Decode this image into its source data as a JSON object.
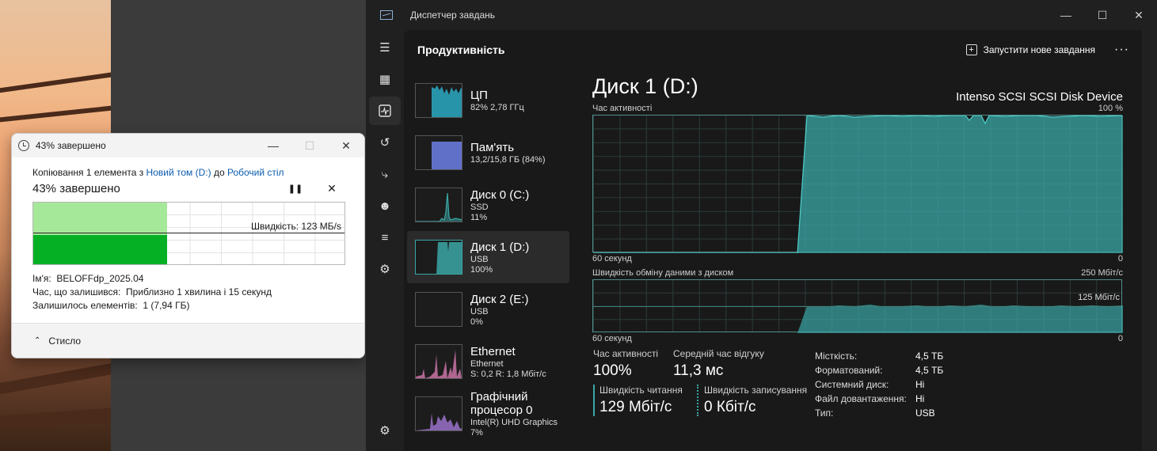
{
  "copy_dialog": {
    "title": "43% завершено",
    "line_prefix": "Копіювання 1 елемента з ",
    "source": "Новий том (D:)",
    "line_mid": " до ",
    "destination": "Робочий стіл",
    "progress_text": "43% завершено",
    "progress_value": 0.43,
    "speed_label": "Швидкість: 123 МБ/s",
    "name_label": "Ім'я:",
    "name_value": "BELOFFdp_2025.04",
    "time_label": "Час, що залишився:",
    "time_value": "Приблизно 1 хвилина і 15 секунд",
    "items_label": "Залишилось елементів:",
    "items_value": "1 (7,94 ГБ)",
    "footer_label": "Стисло"
  },
  "taskmgr": {
    "window_title": "Диспетчер завдань",
    "page_title": "Продуктивність",
    "run_task_label": "Запустити нове завдання",
    "nav_icons": [
      "menu-icon",
      "processes-icon",
      "performance-icon",
      "history-icon",
      "startup-icon",
      "users-icon",
      "details-icon",
      "services-icon"
    ],
    "resources": [
      {
        "name": "ЦП",
        "sub1": "82% 2,78 ГГц",
        "sub2": "",
        "color": "#2aa9c3"
      },
      {
        "name": "Пам'ять",
        "sub1": "13,2/15,8 ГБ (84%)",
        "sub2": "",
        "color": "#6c7fe8"
      },
      {
        "name": "Диск 0 (C:)",
        "sub1": "SSD",
        "sub2": "11%",
        "color": "#3aa7a6"
      },
      {
        "name": "Диск 1 (D:)",
        "sub1": "USB",
        "sub2": "100%",
        "color": "#3aa7a6"
      },
      {
        "name": "Диск 2 (E:)",
        "sub1": "USB",
        "sub2": "0%",
        "color": "#3aa7a6"
      },
      {
        "name": "Ethernet",
        "sub1": "Ethernet",
        "sub2": "S: 0,2 R: 1,8 Мбіт/с",
        "color": "#e07fb8"
      },
      {
        "name": "Графічний процесор 0",
        "sub1": "Intel(R) UHD Graphics",
        "sub2": "7%",
        "color": "#a277d6"
      }
    ],
    "disk_title": "Диск 1 (D:)",
    "disk_model": "Intenso SCSI SCSI Disk Device",
    "chart1": {
      "label": "Час активності",
      "max_label": "100 %",
      "x_left": "60 секунд",
      "x_right": "0"
    },
    "chart2": {
      "label": "Швидкість обміну даними з диском",
      "max_label": "250 Мбіт/с",
      "mid_label": "125 Мбіт/с",
      "x_left": "60 секунд",
      "x_right": "0"
    },
    "stats": {
      "active_label": "Час активності",
      "active_value": "100%",
      "resp_label": "Середній час відгуку",
      "resp_value": "11,3 мс",
      "read_label": "Швидкість читання",
      "read_value": "129 Мбіт/с",
      "write_label": "Швидкість записування",
      "write_value": "0 Кбіт/с"
    },
    "props": [
      {
        "label": "Місткість:",
        "value": "4,5 ТБ"
      },
      {
        "label": "Форматований:",
        "value": "4,5 ТБ"
      },
      {
        "label": "Системний диск:",
        "value": "Ні"
      },
      {
        "label": "Файл довантаження:",
        "value": "Ні"
      },
      {
        "label": "Тип:",
        "value": "USB"
      }
    ]
  }
}
